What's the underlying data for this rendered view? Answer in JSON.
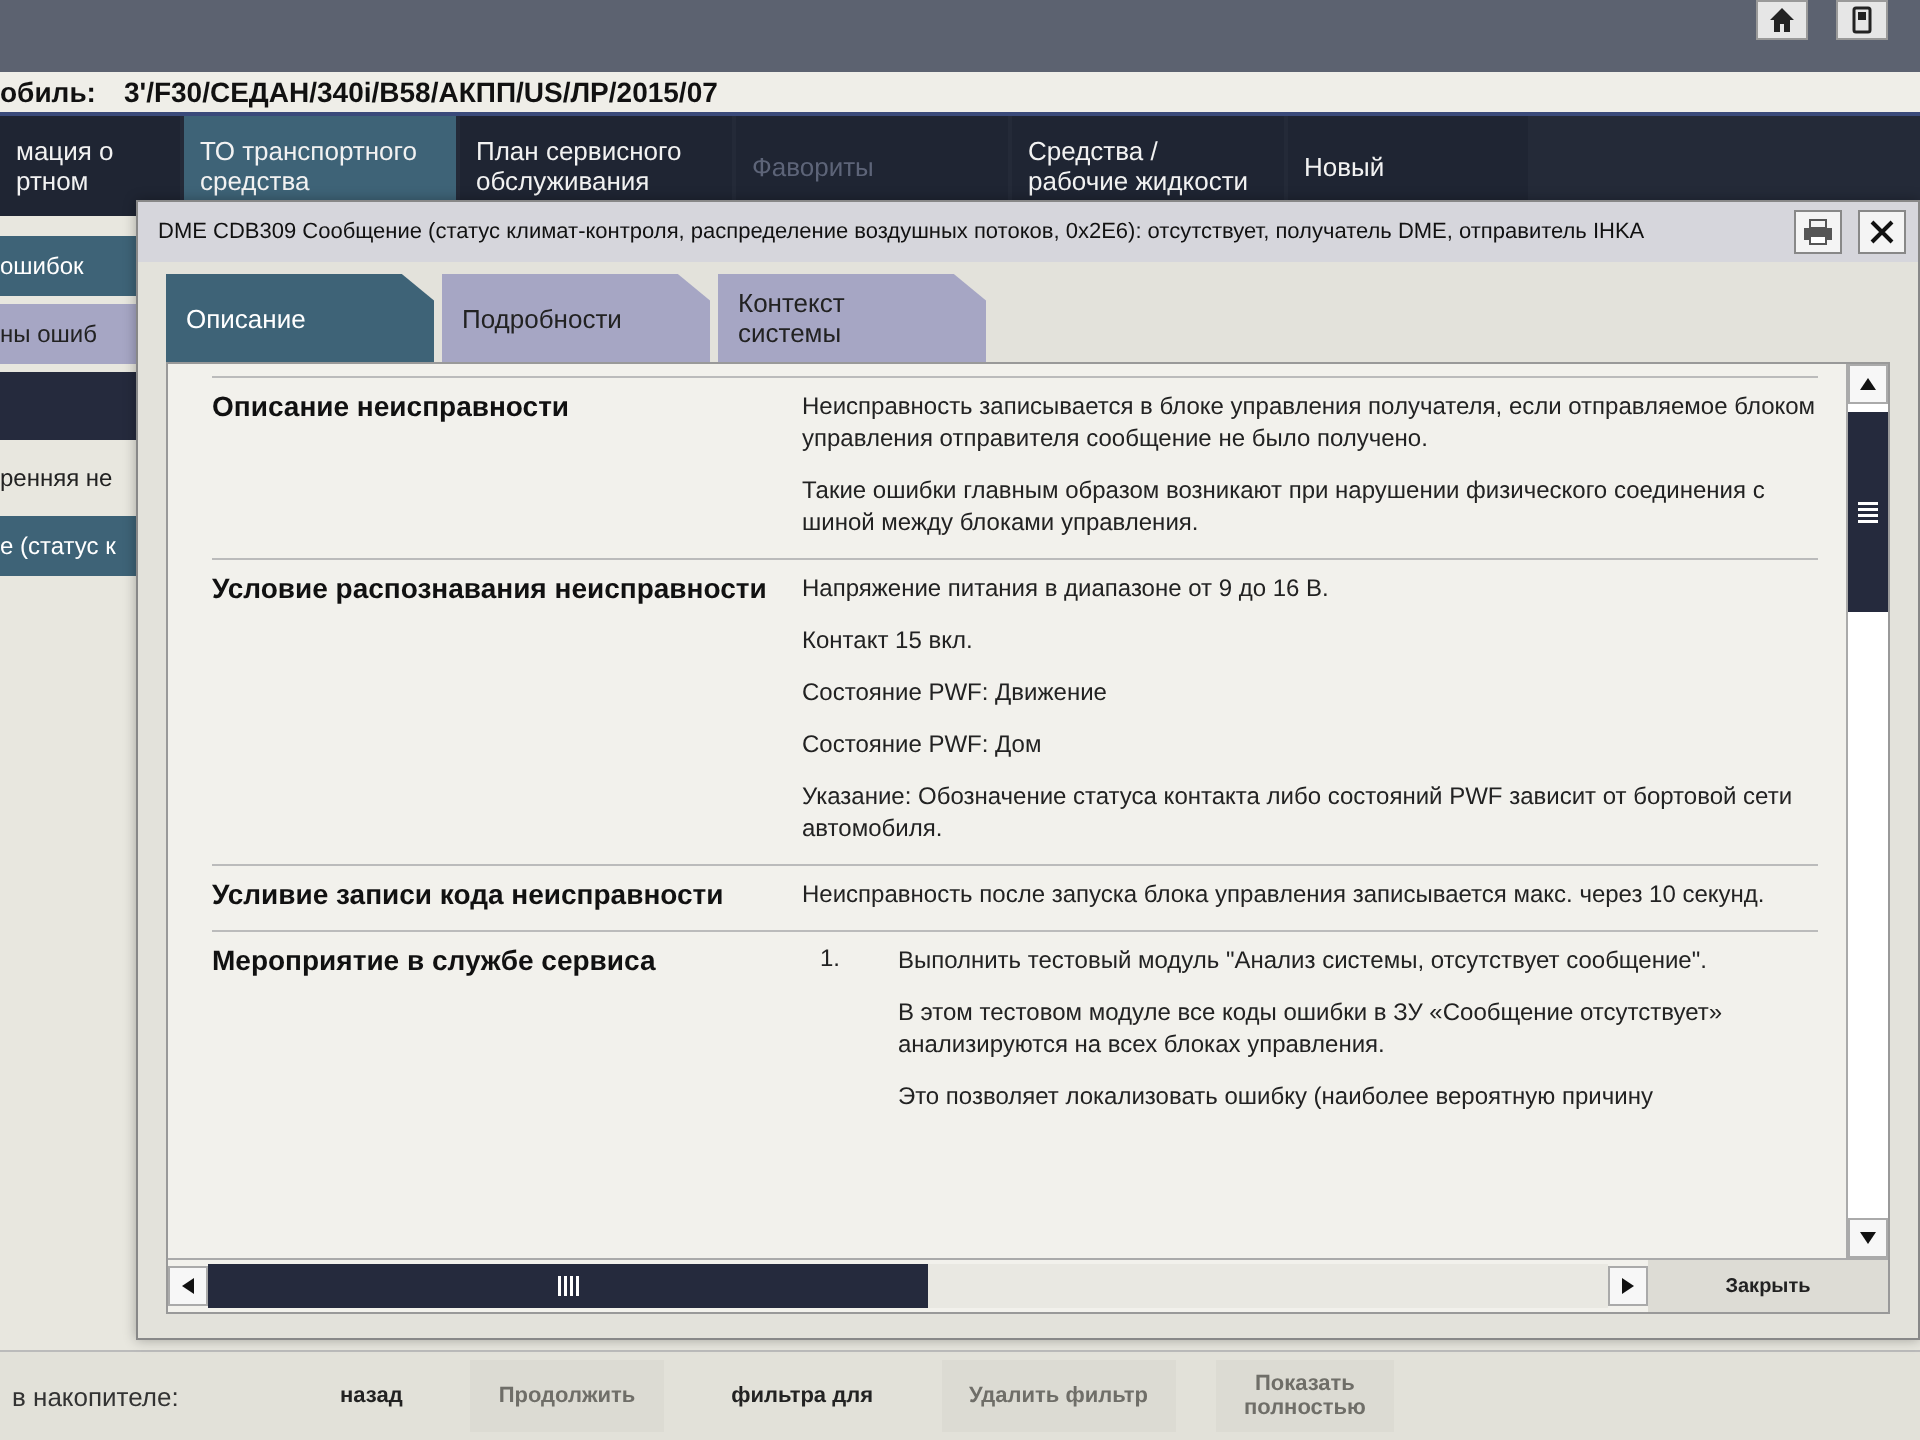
{
  "vehicle": {
    "label": "обиль:",
    "value": "3'/F30/СЕДАН/340i/B58/АКПП/US/ЛР/2015/07"
  },
  "nav_tabs": [
    {
      "label": "мация о\nртном",
      "selected": false,
      "disabled": false
    },
    {
      "label": "ТО транспортного\nсредства",
      "selected": true,
      "disabled": false
    },
    {
      "label": "План сервисного\nобслуживания",
      "selected": false,
      "disabled": false
    },
    {
      "label": "Фавориты",
      "selected": false,
      "disabled": true
    },
    {
      "label": "Средства /\nрабочие жидкости",
      "selected": false,
      "disabled": false
    },
    {
      "label": "Новый",
      "selected": false,
      "disabled": false
    }
  ],
  "sidebar": {
    "items": [
      {
        "label": "ошибок",
        "kind": "dark"
      },
      {
        "label": "ны ошиб",
        "kind": "lavender"
      },
      {
        "label": "ренняя не",
        "kind": "plain"
      },
      {
        "label": "е (статус к",
        "kind": "teal"
      }
    ]
  },
  "footer": {
    "label": "в накопителе:",
    "buttons": [
      {
        "label": "назад",
        "disabled": false
      },
      {
        "label": "Продолжить",
        "disabled": true
      },
      {
        "label": "фильтра для",
        "disabled": false
      },
      {
        "label": "Удалить фильтр",
        "disabled": true
      },
      {
        "label": "Показать\nполностью",
        "disabled": true
      }
    ]
  },
  "dialog": {
    "title": "DME CDB309 Сообщение (статус климат-контроля, распределение воздушных потоков, 0x2E6): отсутствует, получатель DME, отправитель IHKA",
    "tabs": [
      {
        "label": "Описание",
        "selected": true
      },
      {
        "label": "Подробности",
        "selected": false
      },
      {
        "label": "Контекст\nсистемы",
        "selected": false
      }
    ],
    "rows": [
      {
        "label": "Описание неисправности",
        "paragraphs": [
          "Неисправность записывается в блоке управления получателя, если отправляемое блоком управления отправителя сообщение не было получено.",
          "Такие ошибки главным образом возникают при нарушении физического соединения с шиной между блоками управления."
        ]
      },
      {
        "label": "Условие распознавания неисправности",
        "paragraphs": [
          "Напряжение питания в диапазоне от 9 до 16 В.",
          "Контакт 15 вкл.",
          "Состояние PWF: Движение",
          "Состояние PWF: Дом",
          "Указание: Обозначение статуса контакта либо состояний PWF зависит от бортовой сети автомобиля."
        ]
      },
      {
        "label": "Усливие записи кода неисправности",
        "paragraphs": [
          "Неисправность после запуска блока управления записывается макс. через 10 секунд."
        ]
      },
      {
        "label": "Мероприятие в службе сервиса",
        "number": "1.",
        "paragraphs": [
          "Выполнить тестовый модуль \"Анализ системы, отсутствует сообщение\".",
          "В этом тестовом модуле все коды ошибки в ЗУ «Сообщение отсутствует» анализируются на всех блоках управления.",
          "Это позволяет локализовать ошибку (наиболее вероятную причину"
        ]
      }
    ],
    "close_button": "Закрыть"
  }
}
